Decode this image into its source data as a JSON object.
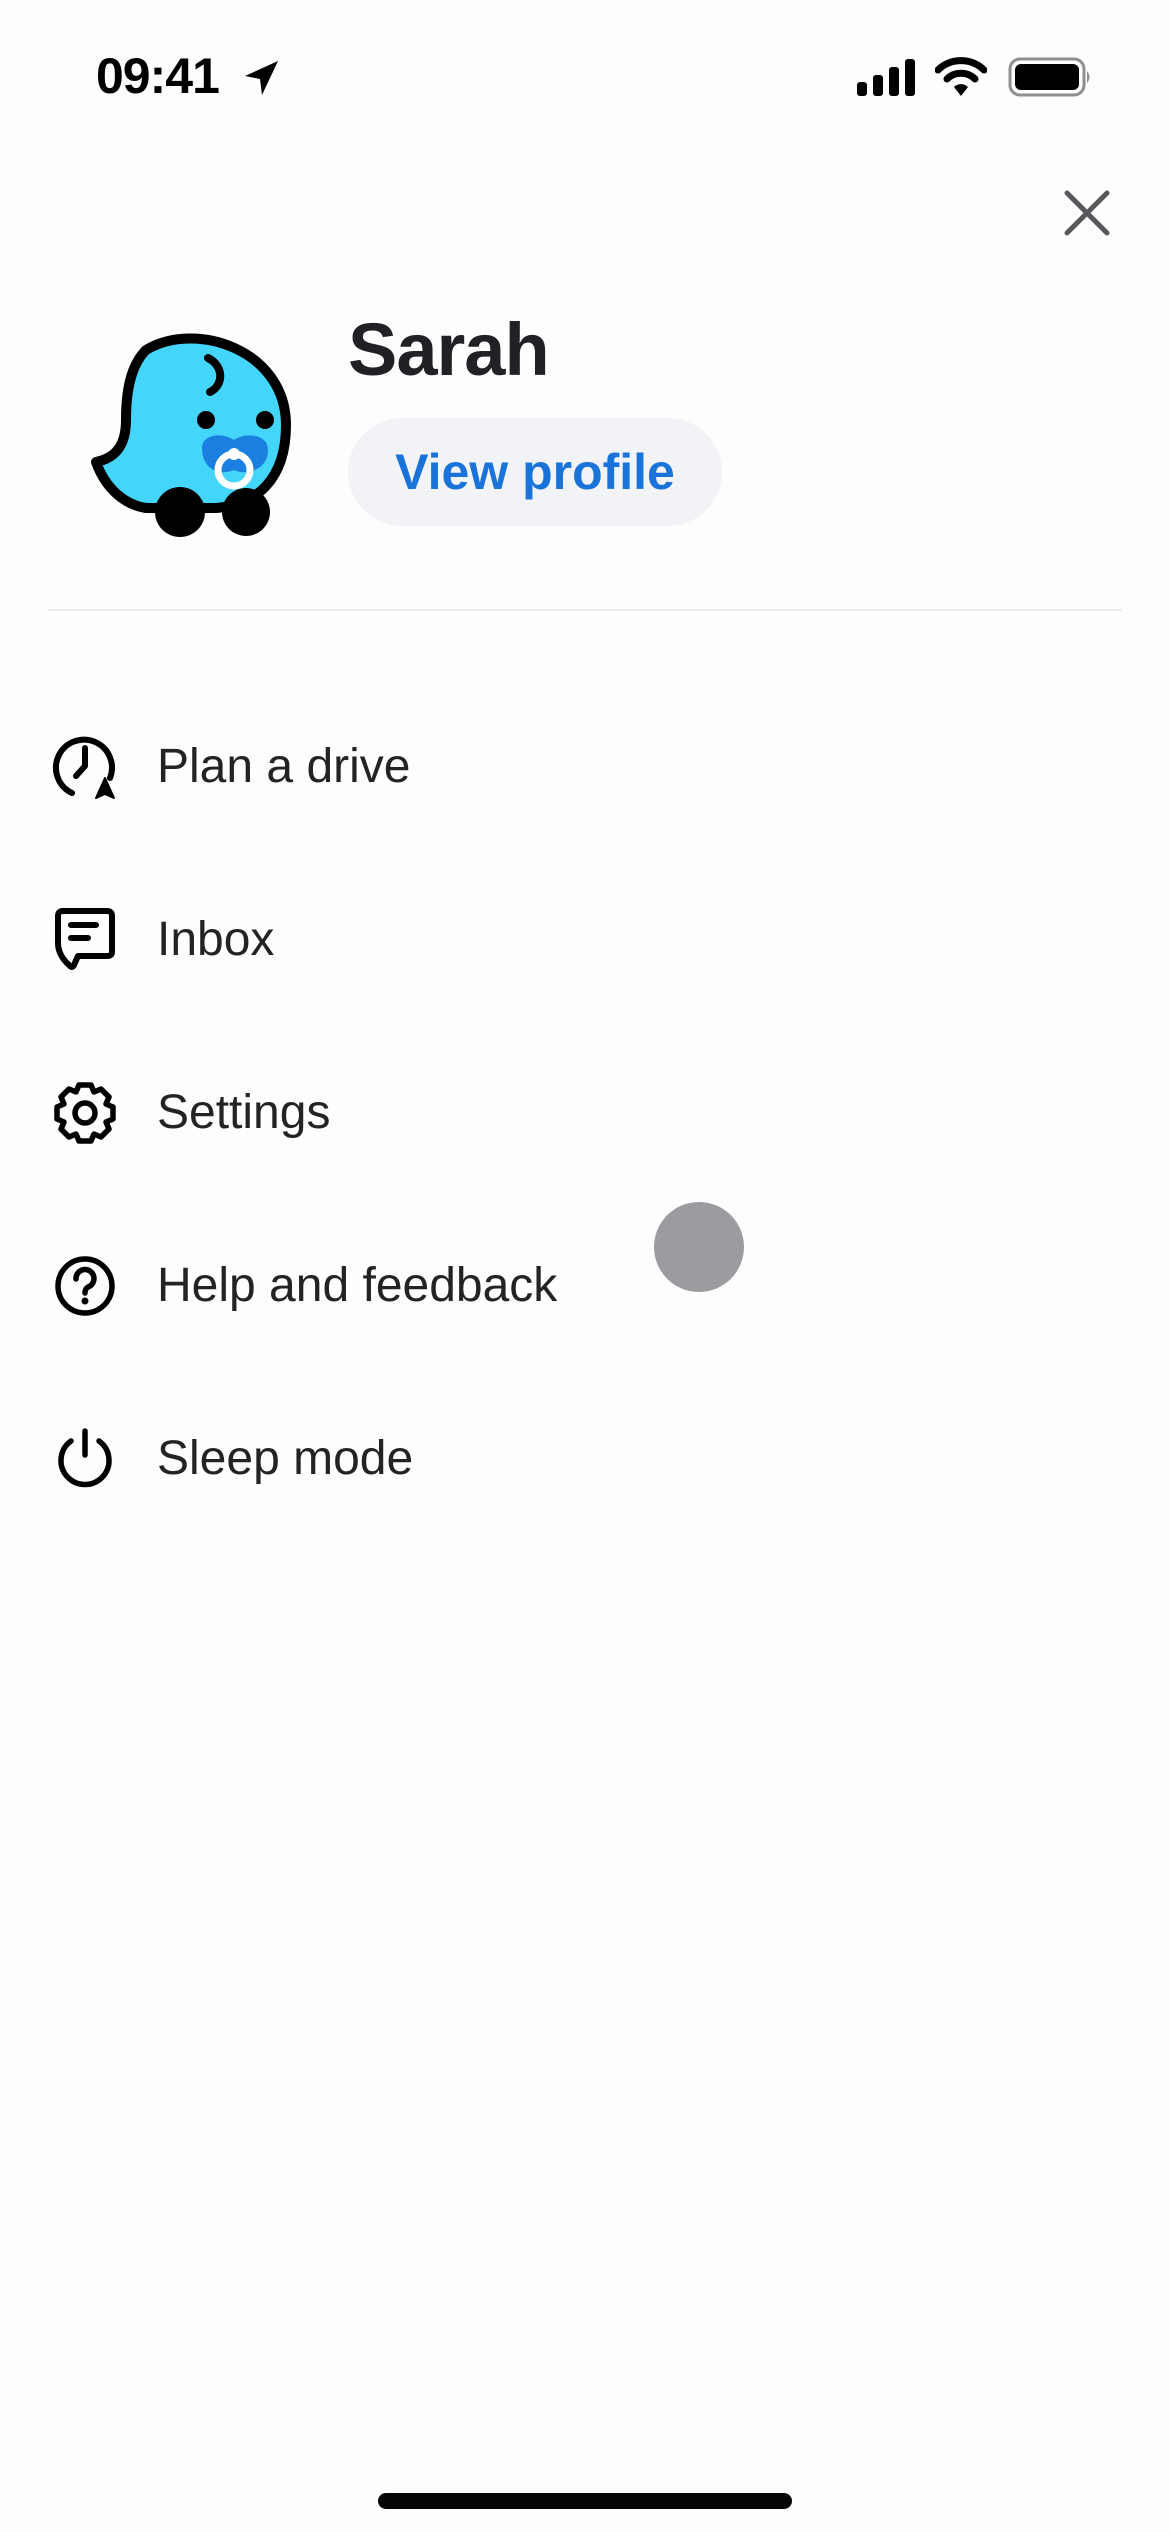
{
  "status_bar": {
    "time": "09:41",
    "icons": [
      "location-arrow-icon",
      "cellular-signal-icon",
      "wifi-icon",
      "battery-icon"
    ]
  },
  "header": {
    "close_icon": "close-icon",
    "user_name": "Sarah",
    "avatar_icon": "waze-baby-avatar-icon",
    "view_profile_label": "View profile"
  },
  "menu": {
    "items": [
      {
        "label": "Plan a drive",
        "icon": "clock-navigation-icon"
      },
      {
        "label": "Inbox",
        "icon": "message-bubble-icon"
      },
      {
        "label": "Settings",
        "icon": "gear-icon"
      },
      {
        "label": "Help and feedback",
        "icon": "help-circle-icon"
      },
      {
        "label": "Sleep mode",
        "icon": "power-icon"
      }
    ]
  },
  "colors": {
    "accent": "#1a73d9",
    "button_bg": "#f2f3f7",
    "avatar_body": "#44d5fb",
    "avatar_pacifier": "#1a7fe0",
    "text": "#232326",
    "touch_indicator": "#9c9b9f"
  }
}
